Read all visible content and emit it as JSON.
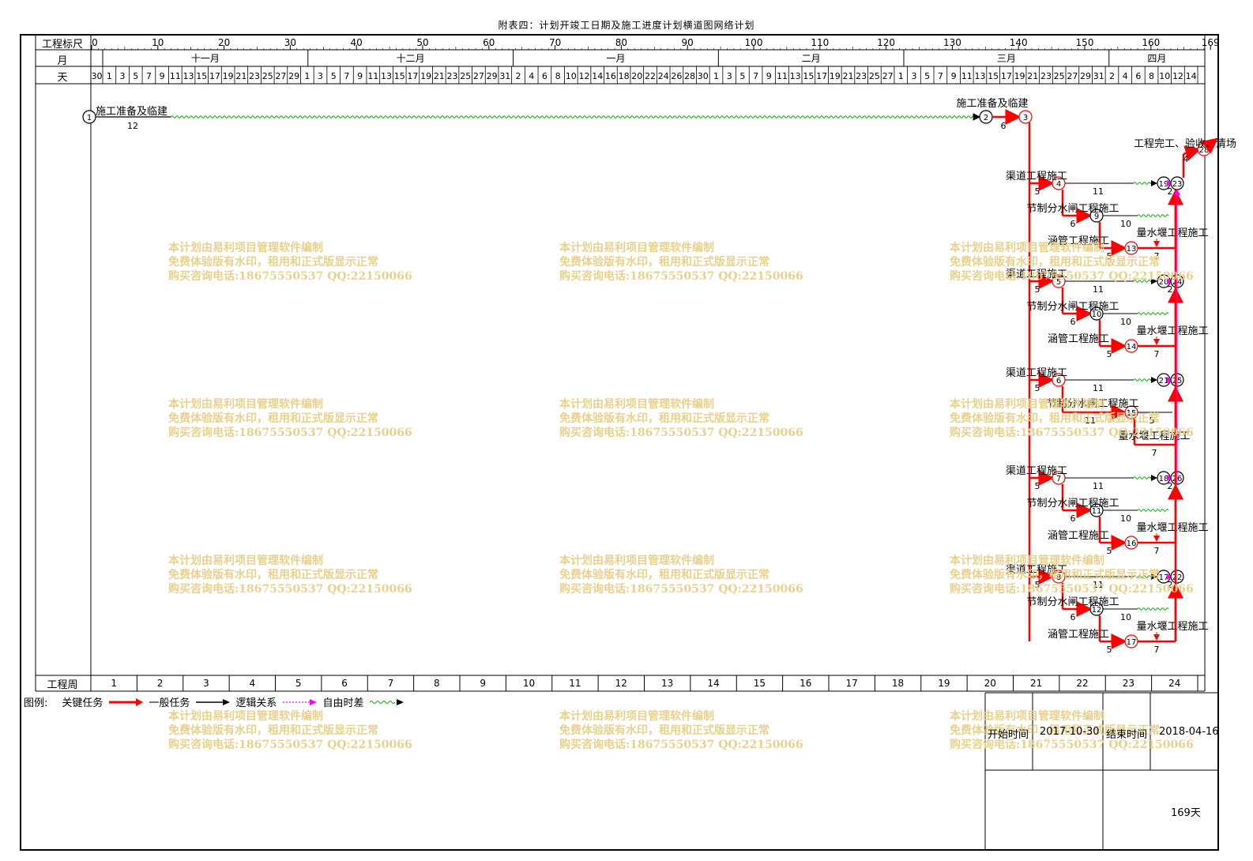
{
  "title": "附表四：计划开竣工日期及施工进度计划横道图网络计划",
  "header": {
    "ruler_label": "工程标尺",
    "month_label": "月",
    "day_label": "天",
    "week_label": "工程周",
    "ruler_ticks": [
      "0",
      "10",
      "20",
      "30",
      "40",
      "50",
      "60",
      "70",
      "80",
      "90",
      "100",
      "110",
      "120",
      "130",
      "140",
      "150",
      "160",
      "169"
    ],
    "months": [
      {
        "label": "十一月",
        "start": 1,
        "end": 31
      },
      {
        "label": "十二月",
        "start": 32,
        "end": 62
      },
      {
        "label": "一月",
        "start": 63,
        "end": 93
      },
      {
        "label": "二月",
        "start": 94,
        "end": 121
      },
      {
        "label": "三月",
        "start": 122,
        "end": 152
      },
      {
        "label": "四月",
        "start": 153,
        "end": 169
      }
    ],
    "days": [
      "30",
      "1",
      "3",
      "5",
      "7",
      "9",
      "11",
      "13",
      "15",
      "17",
      "19",
      "21",
      "23",
      "25",
      "27",
      "29",
      "1",
      "3",
      "5",
      "7",
      "9",
      "11",
      "13",
      "15",
      "17",
      "19",
      "21",
      "23",
      "25",
      "27",
      "29",
      "31",
      "2",
      "4",
      "6",
      "8",
      "10",
      "12",
      "14",
      "16",
      "18",
      "20",
      "22",
      "24",
      "26",
      "28",
      "30",
      "1",
      "3",
      "5",
      "7",
      "9",
      "11",
      "13",
      "15",
      "17",
      "19",
      "21",
      "23",
      "25",
      "27",
      "1",
      "3",
      "5",
      "7",
      "9",
      "11",
      "13",
      "15",
      "17",
      "19",
      "21",
      "23",
      "25",
      "27",
      "29",
      "31",
      "2",
      "4",
      "6",
      "8",
      "10",
      "12",
      "14"
    ],
    "weeks": [
      "1",
      "2",
      "3",
      "4",
      "5",
      "6",
      "7",
      "8",
      "9",
      "10",
      "11",
      "12",
      "13",
      "14",
      "15",
      "16",
      "17",
      "18",
      "19",
      "20",
      "21",
      "22",
      "23",
      "24"
    ]
  },
  "tasks": {
    "prep1": {
      "name": "施工准备及临建",
      "duration": "12"
    },
    "prep2": {
      "name": "施工准备及临建",
      "duration": "6"
    },
    "finish": {
      "name": "工程完工、验收、清场",
      "duration": "4"
    },
    "groups": [
      {
        "channel": "渠道工程施工",
        "sluice": "节制分水闸工程施工",
        "culvert": "涵管工程施工",
        "weir": "量水堰工程施工",
        "d_channel": "5",
        "d_channel_free": "11",
        "d_sluice": "6",
        "d_sluice_free": "10",
        "d_culvert": "5",
        "d_weir": "7",
        "slack": "2",
        "nodes": [
          "4",
          "9",
          "13",
          "19",
          "23"
        ]
      },
      {
        "channel": "渠道工程施工",
        "sluice": "节制分水闸工程施工",
        "culvert": "涵管工程施工",
        "weir": "量水堰工程施工",
        "d_channel": "5",
        "d_channel_free": "11",
        "d_sluice": "6",
        "d_sluice_free": "10",
        "d_culvert": "5",
        "d_weir": "7",
        "slack": "2",
        "nodes": [
          "5",
          "10",
          "14",
          "20",
          "24"
        ]
      },
      {
        "channel": "渠道工程施工",
        "sluice": "节制分水闸工程施工",
        "culvert": "",
        "weir": "量水堰工程施工",
        "d_channel": "5",
        "d_channel_free": "11",
        "d_sluice": "11",
        "d_sluice_free": "5",
        "d_culvert": "",
        "d_weir": "7",
        "slack": "",
        "nodes": [
          "6",
          "15",
          "21",
          "25"
        ]
      },
      {
        "channel": "渠道工程施工",
        "sluice": "节制分水闸工程施工",
        "culvert": "涵管工程施工",
        "weir": "量水堰工程施工",
        "d_channel": "5",
        "d_channel_free": "11",
        "d_sluice": "6",
        "d_sluice_free": "10",
        "d_culvert": "5",
        "d_weir": "7",
        "slack": "2",
        "nodes": [
          "7",
          "11",
          "16",
          "18",
          "26"
        ]
      },
      {
        "channel": "渠道工程施工",
        "sluice": "节制分水闸工程施工",
        "culvert": "涵管工程施工",
        "weir": "量水堰工程施工",
        "d_channel": "5",
        "d_channel_free": "11",
        "d_sluice": "6",
        "d_sluice_free": "10",
        "d_culvert": "5",
        "d_weir": "7",
        "slack": "2",
        "nodes": [
          "8",
          "12",
          "17",
          "22"
        ]
      }
    ],
    "node_start": "1",
    "node_2": "2",
    "node_3": "3",
    "node_end": "28"
  },
  "watermark": {
    "line1": "本计划由易利项目管理软件编制",
    "line2": "免费体验版有水印，租用和正式版显示正常",
    "line3": "购买咨询电话:18675550537 QQ:22150066"
  },
  "legend": {
    "label": "图例:",
    "critical": "关键任务",
    "general": "一般任务",
    "logic": "逻辑关系",
    "free_float": "自由时差",
    "colors": {
      "critical": "#ff0000",
      "general": "#000000",
      "logic": "#ff00ff",
      "free_float": "#00aa00"
    }
  },
  "info": {
    "start_label": "开始时间",
    "start_value": "2017-10-30",
    "end_label": "结束时间",
    "end_value": "2018-04-16",
    "total": "169天"
  }
}
